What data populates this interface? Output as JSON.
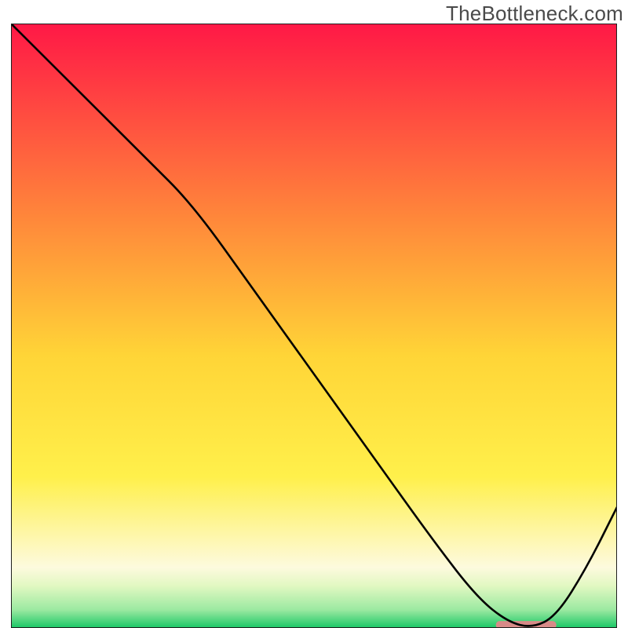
{
  "watermark": "TheBottleneck.com",
  "chart_data": {
    "type": "line",
    "title": "",
    "xlabel": "",
    "ylabel": "",
    "xlim": [
      0,
      100
    ],
    "ylim": [
      0,
      100
    ],
    "series": [
      {
        "name": "curve",
        "x": [
          0,
          10,
          22,
          30,
          40,
          50,
          60,
          70,
          77,
          82,
          86,
          90,
          95,
          100
        ],
        "values": [
          100,
          90,
          78,
          70,
          56,
          42,
          28,
          14,
          5,
          1,
          0,
          2,
          10,
          20
        ]
      }
    ],
    "marker": {
      "name": "optimal-range",
      "x_start": 80,
      "x_end": 90,
      "y": 0.5,
      "color": "#d88a88"
    },
    "background_gradient": {
      "stops": [
        {
          "offset": 0.0,
          "color": "#ff1846"
        },
        {
          "offset": 0.33,
          "color": "#ff8a3a"
        },
        {
          "offset": 0.55,
          "color": "#ffd537"
        },
        {
          "offset": 0.75,
          "color": "#fff04b"
        },
        {
          "offset": 0.9,
          "color": "#fdfade"
        },
        {
          "offset": 0.93,
          "color": "#e2f8c2"
        },
        {
          "offset": 0.97,
          "color": "#9be9a1"
        },
        {
          "offset": 1.0,
          "color": "#18c765"
        }
      ]
    }
  }
}
